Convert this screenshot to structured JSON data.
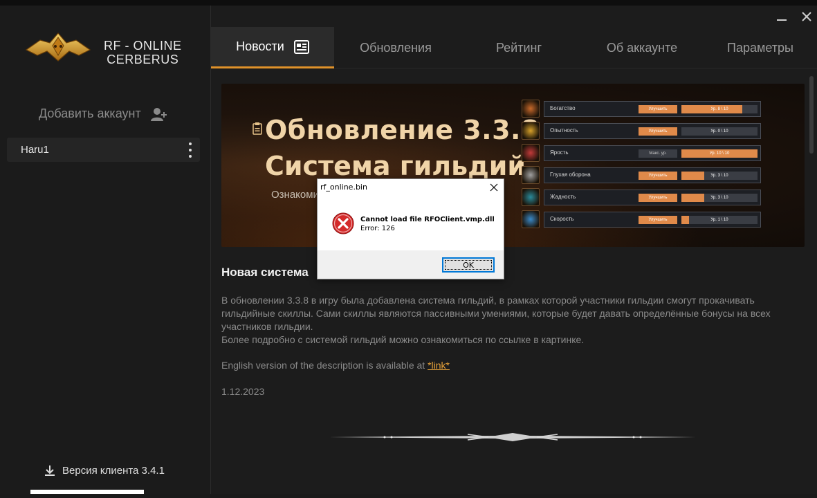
{
  "app": {
    "brand_line1": "RF - ONLINE",
    "brand_line2": "CERBERUS"
  },
  "sidebar": {
    "add_account_label": "Добавить аккаунт",
    "accounts": [
      {
        "name": "Haru1"
      }
    ],
    "version_label": "Версия клиента 3.4.1"
  },
  "tabs": [
    {
      "label": "Новости",
      "active": true
    },
    {
      "label": "Обновления",
      "active": false
    },
    {
      "label": "Рейтинг",
      "active": false
    },
    {
      "label": "Об аккаунте",
      "active": false
    },
    {
      "label": "Параметры",
      "active": false
    }
  ],
  "banner": {
    "title_line1": "Обновление 3.3.8",
    "title_line2": "Система гильдий",
    "subtitle": "Ознакоми",
    "skills": [
      {
        "name": "Богатство",
        "button": "Улучшить",
        "level": "Ур. 8 \\ 10",
        "progress": 0.8
      },
      {
        "name": "Опытность",
        "button": "Улучшить",
        "level": "Ур. 0 \\ 10",
        "progress": 0.0
      },
      {
        "name": "Ярость",
        "button": "Макс. ур.",
        "level": "Ур. 10 \\ 10",
        "progress": 1.0
      },
      {
        "name": "Глухая оборона",
        "button": "Улучшить",
        "level": "Ур. 3 \\ 10",
        "progress": 0.3
      },
      {
        "name": "Жадность",
        "button": "Улучшить",
        "level": "Ур. 3 \\ 10",
        "progress": 0.3
      },
      {
        "name": "Скорость",
        "button": "Улучшить",
        "level": "Ур. 1 \\ 10",
        "progress": 0.1
      }
    ]
  },
  "article": {
    "title": "Новая система",
    "paragraph1": "В обновлении 3.3.8 в игру была добавлена система гильдий, в рамках которой участники гильдии смогут прокачивать гильдийные скиллы. Сами скиллы являются пассивными умениями, которые будет давать определённые бонусы на всех участников гильдии.",
    "paragraph2": "Более подробно с системой гильдий можно ознакомиться по ссылке в картинке.",
    "english_prefix": "English version of the description is available at ",
    "english_link": "*link*",
    "date": "1.12.2023"
  },
  "dialog": {
    "title": "rf_online.bin",
    "message_line1": "Cannot load file RFOClient.vmp.dll",
    "message_line2": "Error: 126",
    "ok_label": "OK",
    "icon": "error-icon"
  },
  "colors": {
    "accent": "#e0922a",
    "link": "#e8a33a",
    "skill_orange": "#e08a4a"
  }
}
